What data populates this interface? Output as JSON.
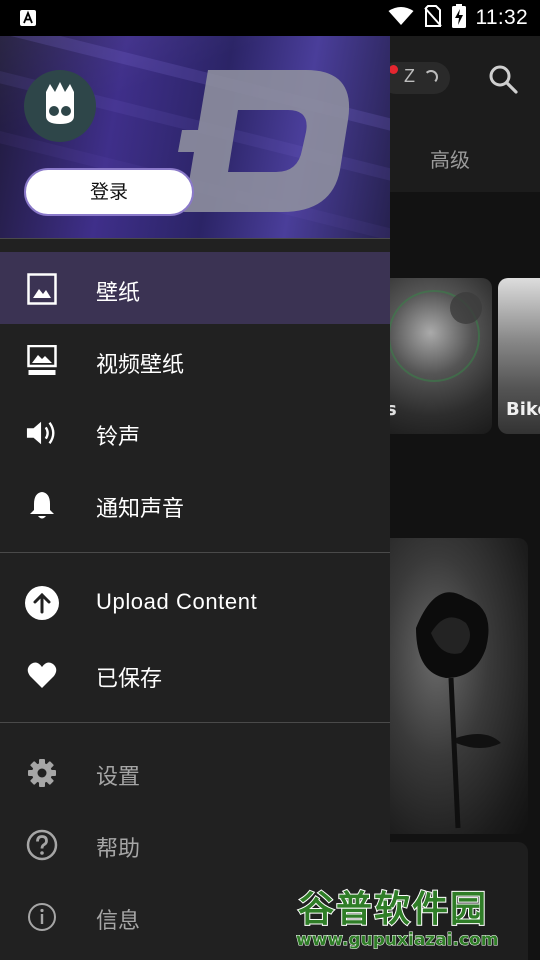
{
  "status_bar": {
    "time": "11:32",
    "icons": [
      "font-a-icon",
      "wifi-icon",
      "no-sim-icon",
      "battery-charging-icon"
    ]
  },
  "background": {
    "pill_letter": "Z",
    "tab_label": "高级",
    "card1_label": "s",
    "card2_label": "Bike"
  },
  "drawer": {
    "login_label": "登录",
    "menu_primary": [
      {
        "label": "壁纸",
        "icon": "image-icon",
        "active": true
      },
      {
        "label": "视频壁纸",
        "icon": "video-wallpaper-icon",
        "active": false
      },
      {
        "label": "铃声",
        "icon": "volume-icon",
        "active": false
      },
      {
        "label": "通知声音",
        "icon": "bell-icon",
        "active": false
      }
    ],
    "menu_secondary": [
      {
        "label": "Upload Content",
        "icon": "upload-icon"
      },
      {
        "label": "已保存",
        "icon": "heart-icon"
      }
    ],
    "menu_tertiary": [
      {
        "label": "设置",
        "icon": "gear-icon"
      },
      {
        "label": "帮助",
        "icon": "help-icon"
      },
      {
        "label": "信息",
        "icon": "info-icon"
      }
    ],
    "colors": {
      "header_accent": "#3f2f8a",
      "active_item_bg": "#3b3353",
      "drawer_bg": "#212121"
    }
  },
  "watermark": {
    "title": "谷普软件园",
    "url": "www.gupuxiazai.com"
  }
}
